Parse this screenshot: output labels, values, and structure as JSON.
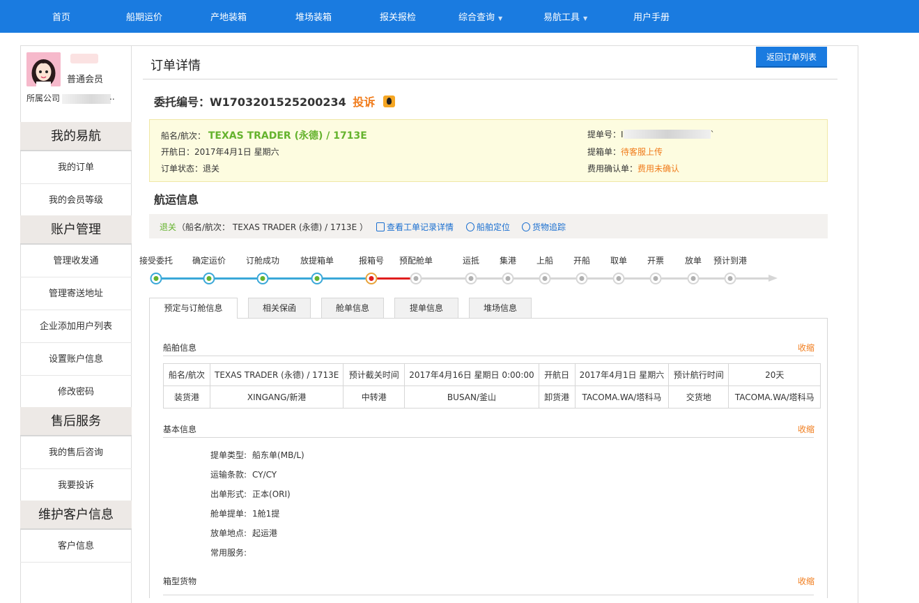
{
  "nav": {
    "items": [
      "首页",
      "船期运价",
      "产地装箱",
      "堆场装箱",
      "报关报检",
      "综合查询",
      "易航工具",
      "用户手册"
    ]
  },
  "profile": {
    "member_level": "普通会员",
    "company_label": "所属公司",
    "company_tail": ".."
  },
  "sidebar": {
    "sections": [
      "我的易航",
      "账户管理",
      "售后服务",
      "维护客户信息"
    ],
    "items": [
      "我的订单",
      "我的会员等级",
      "管理收发通",
      "管理寄送地址",
      "企业添加用户列表",
      "设置账户信息",
      "修改密码",
      "我的售后咨询",
      "我要投诉",
      "客户信息"
    ]
  },
  "page": {
    "title": "订单详情",
    "back_button": "返回订单列表",
    "order_label": "委托编号：W1703201525200234",
    "complain": "投诉"
  },
  "info": {
    "vessel_label": "船名/航次：",
    "vessel_value": "TEXAS TRADER (永德) / 1713E",
    "sail_date": "开航日：2017年4月1日 星期六",
    "status": "订单状态：退关",
    "bl_label": "提单号：",
    "bl_value": "I",
    "bl_tail": "`",
    "bl_doc_label": "提箱单：",
    "bl_doc_value": "待客服上传",
    "fee_label": "费用确认单：",
    "fee_value": "费用未确认"
  },
  "shipping": {
    "title": "航运信息",
    "status_word": "退关",
    "status_detail": "（船名/航次： TEXAS TRADER (永德) / 1713E ）",
    "link_worklog": "查看工单记录详情",
    "link_locate": "船舶定位",
    "link_track": "货物追踪"
  },
  "progress": {
    "steps": [
      "接受委托",
      "确定运价",
      "订舱成功",
      "放提箱单",
      "报箱号",
      "预配舱单",
      "运抵",
      "集港",
      "上船",
      "开船",
      "取单",
      "开票",
      "放单",
      "预计到港"
    ],
    "current_index": 4,
    "colors": {
      "done": "#3aa8d8",
      "current": "#e01e1e",
      "todo": "#d6d6d6"
    }
  },
  "tabs": [
    "预定与订舱信息",
    "相关保函",
    "舱单信息",
    "提单信息",
    "堆场信息"
  ],
  "vessel_section": {
    "title": "船舶信息",
    "collapse": "收缩",
    "rows": [
      [
        "船名/航次",
        "TEXAS TRADER (永德) / 1713E",
        "预计截关时间",
        "2017年4月16日 星期日 0:00:00",
        "开航日",
        "2017年4月1日 星期六",
        "预计航行时间",
        "20天"
      ],
      [
        "装货港",
        "XINGANG/新港",
        "中转港",
        "BUSAN/釜山",
        "卸货港",
        "TACOMA.WA/塔科马",
        "交货地",
        "TACOMA.WA/塔科马"
      ]
    ]
  },
  "basic_section": {
    "title": "基本信息",
    "collapse": "收缩",
    "fields": [
      {
        "label": "提单类型:",
        "value": "船东单(MB/L)"
      },
      {
        "label": "运输条款:",
        "value": "CY/CY"
      },
      {
        "label": "出单形式:",
        "value": "正本(ORI)"
      },
      {
        "label": "舱单提单:",
        "value": "1舱1提"
      },
      {
        "label": "放单地点:",
        "value": "起运港"
      },
      {
        "label": "常用服务:",
        "value": ""
      }
    ]
  },
  "cargo_section": {
    "title": "箱型货物",
    "collapse": "收缩"
  }
}
